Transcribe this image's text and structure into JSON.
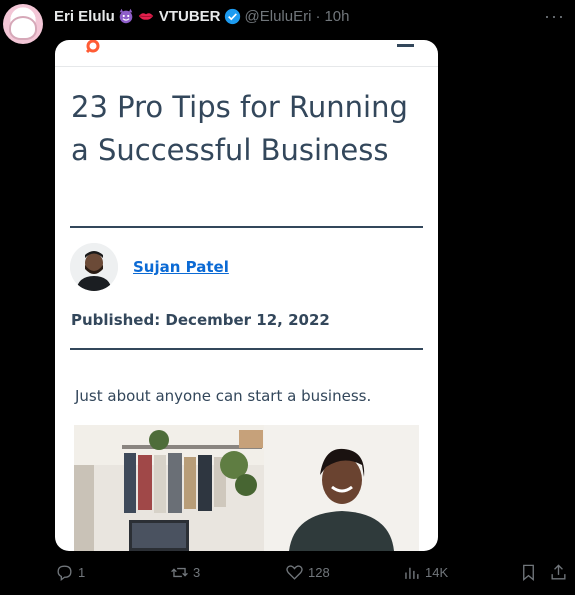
{
  "tweet": {
    "display_name": "Eri Elulu",
    "name_suffix": "VTUBER",
    "handle": "@EluluEri",
    "separator": "·",
    "time": "10h",
    "more_label": "···"
  },
  "article": {
    "headline": "23 Pro Tips for Running a Successful Business",
    "author": "Sujan Patel",
    "published": "Published: December 12, 2022",
    "lede": "Just about anyone can start a business."
  },
  "actions": {
    "replies": "1",
    "reposts": "3",
    "likes": "128",
    "views": "14K"
  },
  "colors": {
    "brand_orange": "#ff5c35",
    "heading": "#33475b",
    "link": "#0b6ad4",
    "verified": "#1d9bf0"
  },
  "icons": [
    "devil-emoji-icon",
    "lips-emoji-icon",
    "verified-badge-icon",
    "reply-icon",
    "repost-icon",
    "like-icon",
    "views-icon",
    "bookmark-icon",
    "share-icon",
    "menu-icon"
  ]
}
